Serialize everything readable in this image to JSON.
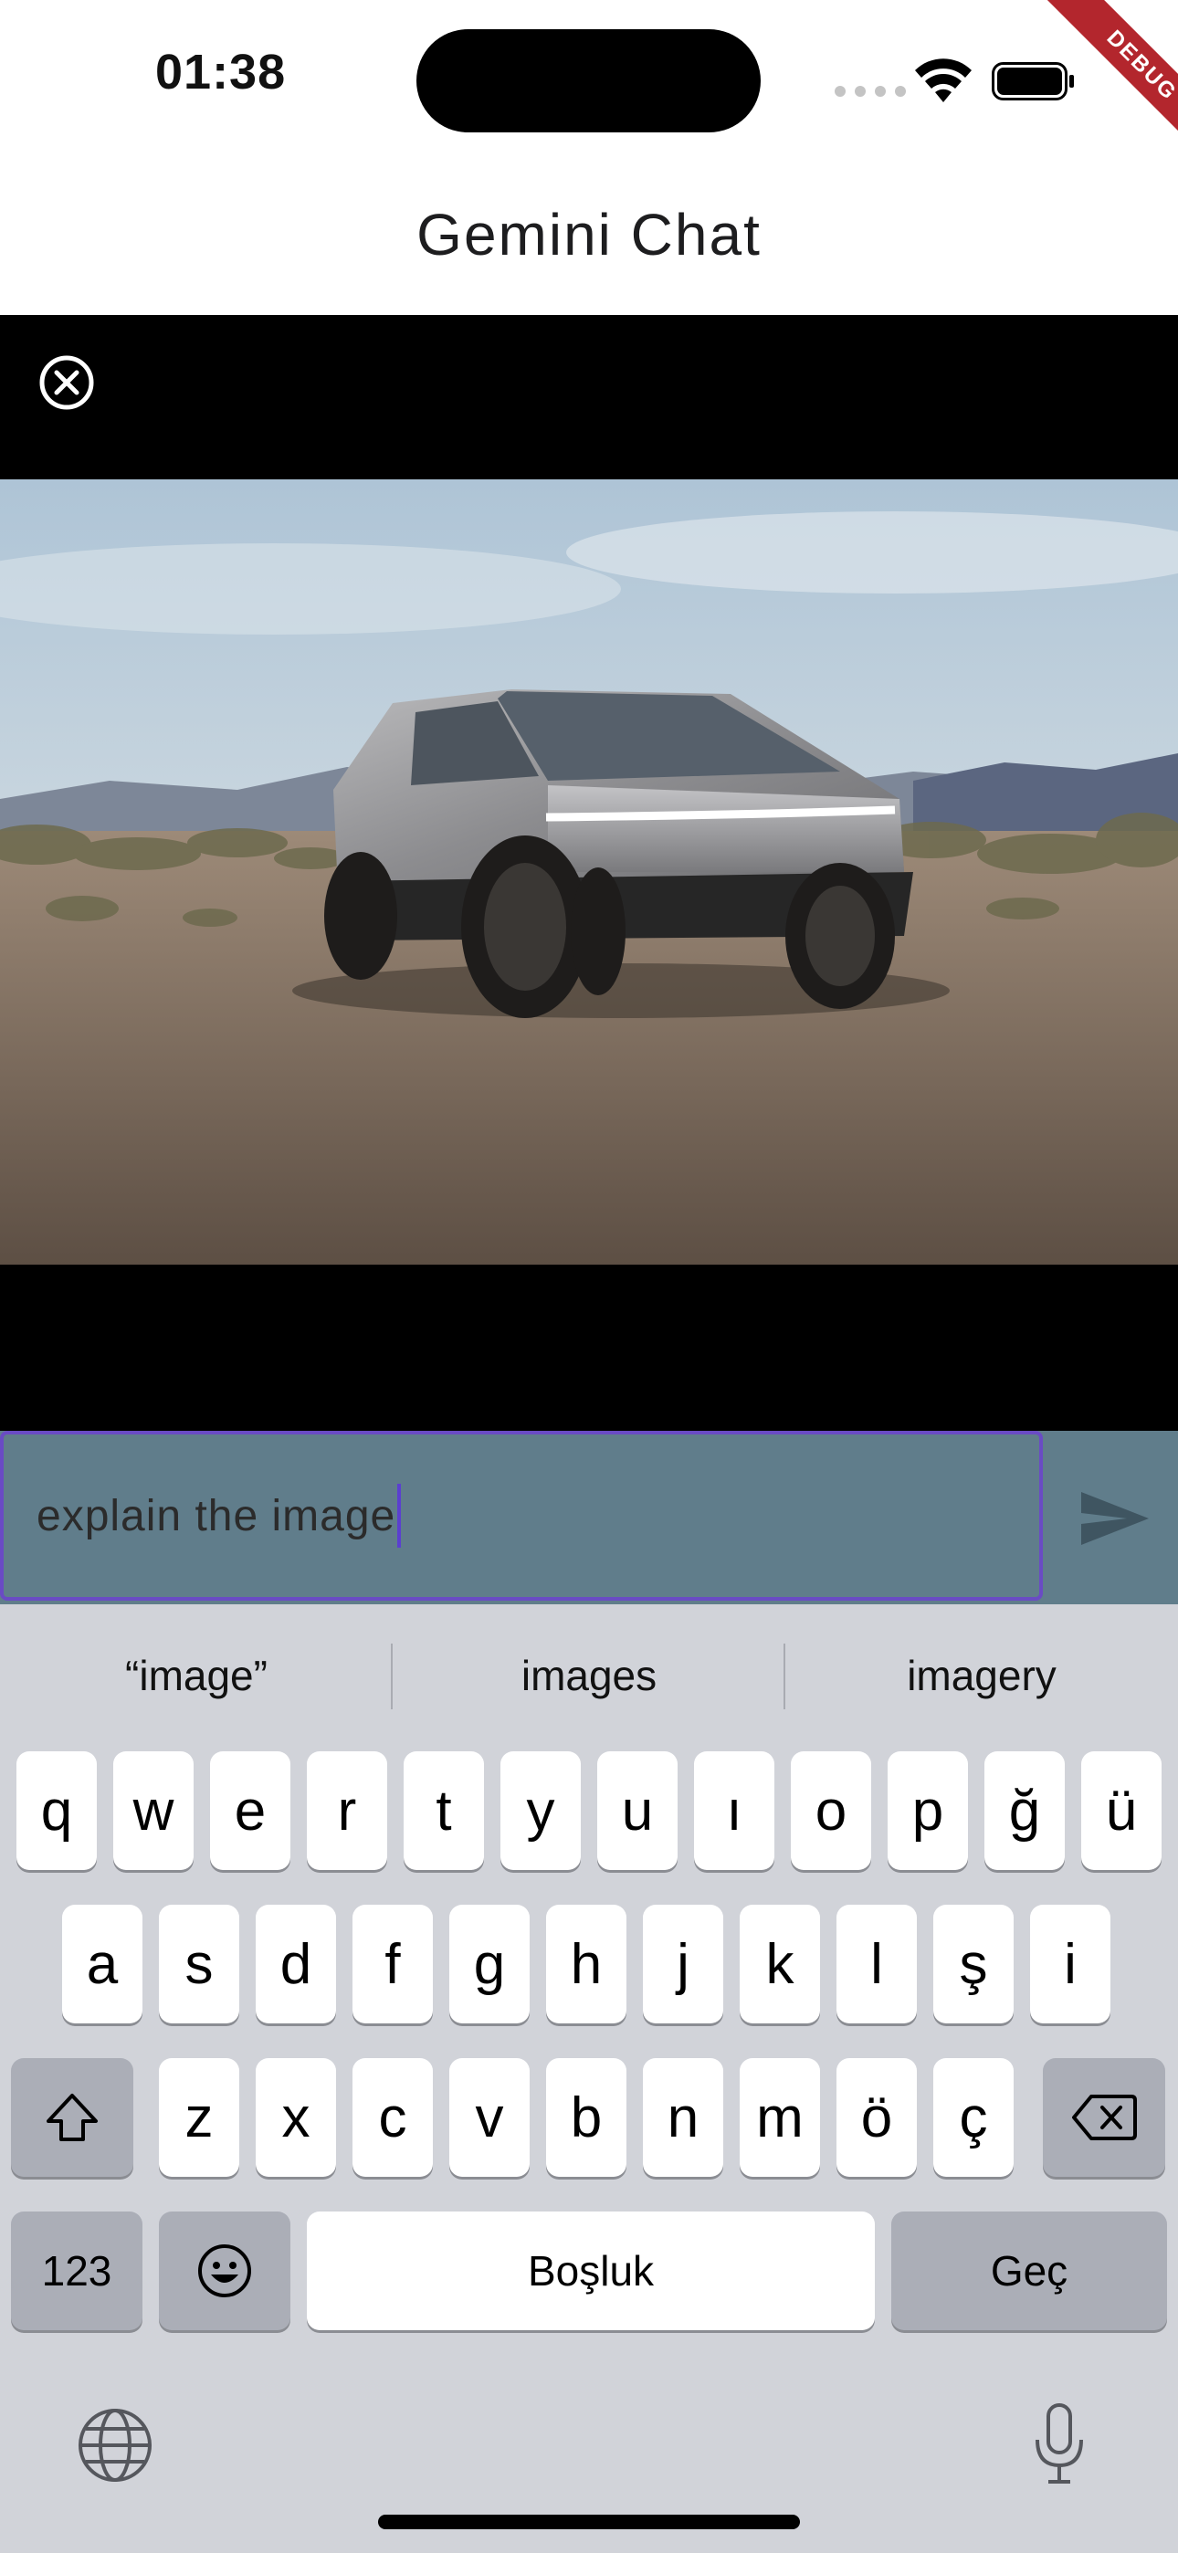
{
  "status_bar": {
    "time": "01:38"
  },
  "debug_banner": "DEBUG",
  "app": {
    "title": "Gemini Chat"
  },
  "viewer": {
    "close_icon": "close-circle-icon",
    "image_alt": "Futuristic angular steel pickup truck in desert landscape"
  },
  "input": {
    "value": "explain the image",
    "send_icon": "send-icon"
  },
  "keyboard": {
    "suggestions": [
      "“image”",
      "images",
      "imagery"
    ],
    "row1": [
      "q",
      "w",
      "e",
      "r",
      "t",
      "y",
      "u",
      "ı",
      "o",
      "p",
      "ğ",
      "ü"
    ],
    "row2": [
      "a",
      "s",
      "d",
      "f",
      "g",
      "h",
      "j",
      "k",
      "l",
      "ş",
      "i"
    ],
    "row3": [
      "z",
      "x",
      "c",
      "v",
      "b",
      "n",
      "m",
      "ö",
      "ç"
    ],
    "numbers_label": "123",
    "space_label": "Boşluk",
    "return_label": "Geç"
  },
  "colors": {
    "input_bar": "#607d8b",
    "input_border": "#6a4bc4",
    "debug_ribbon": "#b3262d",
    "keyboard_bg": "#d1d3d9"
  }
}
